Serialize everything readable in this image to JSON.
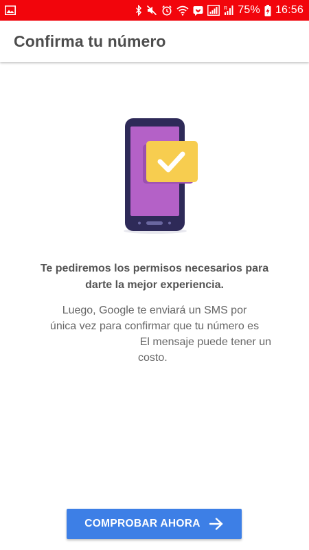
{
  "status_bar": {
    "battery_percent": "75%",
    "time": "16:56",
    "background": "#f2050c",
    "icons": [
      "image-icon",
      "bluetooth-icon",
      "mute-icon",
      "alarm-icon",
      "wifi-icon",
      "chat-notification-icon",
      "signal-icon",
      "roaming-signal-icon",
      "battery-charging-icon"
    ]
  },
  "toolbar": {
    "title": "Confirma tu número"
  },
  "illustration": {
    "icon": "phone-with-check-icon",
    "colors": {
      "phone_body": "#2e2a58",
      "screen": "#b461c7",
      "badge": "#f7cd4f",
      "badge_shadow": "#9b4fb0",
      "check": "#ffffff"
    }
  },
  "content": {
    "headline_line1": "Te pediremos los permisos necesarios para",
    "headline_line2": "darte la mejor experiencia.",
    "body_line1": "Luego, Google te enviará un SMS por",
    "body_line2": "única vez para confirmar que tu número es",
    "body_line3": "El mensaje puede tener un",
    "body_line4": "costo."
  },
  "button": {
    "label": "COMPROBAR AHORA",
    "icon": "arrow-right-icon",
    "color": "#3d7fe6"
  }
}
